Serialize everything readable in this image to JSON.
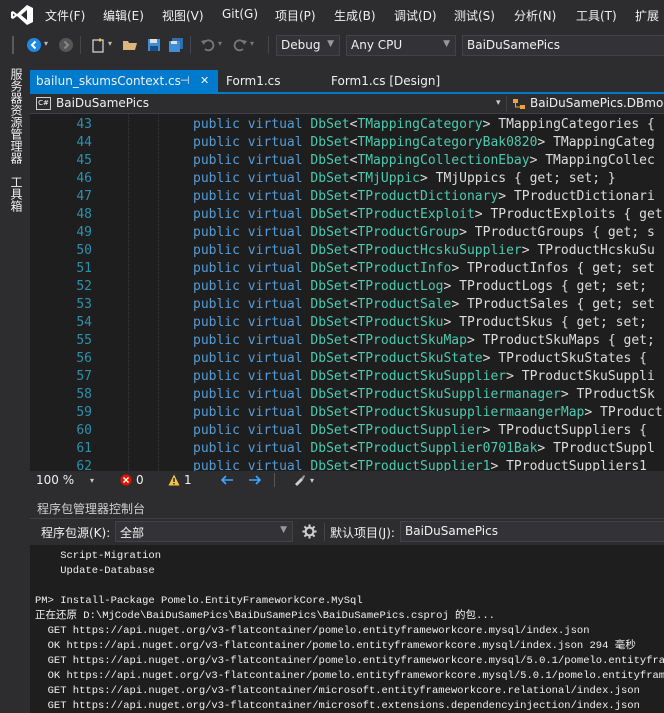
{
  "menu": {
    "items": [
      "文件(F)",
      "编辑(E)",
      "视图(V)",
      "Git(G)",
      "项目(P)",
      "生成(B)",
      "调试(D)",
      "测试(S)",
      "分析(N)",
      "工具(T)",
      "扩展"
    ]
  },
  "toolbar": {
    "config": "Debug",
    "platform": "Any CPU",
    "startup_project": "BaiDuSamePics"
  },
  "left_strip": {
    "server_explorer": "服务器资源管理器",
    "toolbox": "工具箱"
  },
  "tabs": [
    {
      "label": "bailun_skumsContext.cs",
      "pin": "⊣",
      "close": "✕"
    },
    {
      "label": "Form1.cs"
    },
    {
      "label": "Form1.cs [Design]"
    }
  ],
  "navbar": {
    "project": "BaiDuSamePics",
    "class": "BaiDuSamePics.DBmod",
    "project_badge": "C#"
  },
  "code": {
    "lines": [
      {
        "num": "43",
        "type": "TMappingCategory",
        "name": "TMappingCategories",
        "tail": " {"
      },
      {
        "num": "44",
        "type": "TMappingCategoryBak0820",
        "name": "TMappingCateg",
        "tail": ""
      },
      {
        "num": "45",
        "type": "TMappingCollectionEbay",
        "name": "TMappingCollec",
        "tail": ""
      },
      {
        "num": "46",
        "type": "TMjUppic",
        "name": "TMjUppics",
        "tail": " { get; set; }"
      },
      {
        "num": "47",
        "type": "TProductDictionary",
        "name": "TProductDictionari",
        "tail": ""
      },
      {
        "num": "48",
        "type": "TProductExploit",
        "name": "TProductExploits",
        "tail": " { get"
      },
      {
        "num": "49",
        "type": "TProductGroup",
        "name": "TProductGroups",
        "tail": " { get; s"
      },
      {
        "num": "50",
        "type": "TProductHcskuSupplier",
        "name": "TProductHcskuSu",
        "tail": ""
      },
      {
        "num": "51",
        "type": "TProductInfo",
        "name": "TProductInfos",
        "tail": " { get; set"
      },
      {
        "num": "52",
        "type": "TProductLog",
        "name": "TProductLogs",
        "tail": " { get; set;"
      },
      {
        "num": "53",
        "type": "TProductSale",
        "name": "TProductSales",
        "tail": " { get; set"
      },
      {
        "num": "54",
        "type": "TProductSku",
        "name": "TProductSkus",
        "tail": " { get; set;"
      },
      {
        "num": "55",
        "type": "TProductSkuMap",
        "name": "TProductSkuMaps",
        "tail": " { get;"
      },
      {
        "num": "56",
        "type": "TProductSkuState",
        "name": "TProductSkuStates",
        "tail": " {"
      },
      {
        "num": "57",
        "type": "TProductSkuSupplier",
        "name": "TProductSkuSuppli",
        "tail": ""
      },
      {
        "num": "58",
        "type": "TProductSkuSuppliermanager",
        "name": "TProductSk",
        "tail": ""
      },
      {
        "num": "59",
        "type": "TProductSkusuppliermaangerMap",
        "name": "TProduct",
        "tail": ""
      },
      {
        "num": "60",
        "type": "TProductSupplier",
        "name": "TProductSuppliers",
        "tail": " {"
      },
      {
        "num": "61",
        "type": "TProductSupplier0701Bak",
        "name": "TProductSuppl",
        "tail": ""
      },
      {
        "num": "62",
        "type": "TProductSupplier1",
        "name": "TProductSuppliers1",
        "tail": " "
      }
    ],
    "kw_public": "public",
    "kw_virtual": "virtual",
    "dbset": "DbSet"
  },
  "editor_status": {
    "zoom": "100 %",
    "errors": "0",
    "warnings": "1"
  },
  "panel": {
    "title": "程序包管理器控制台",
    "source_label": "程序包源(K):",
    "source_value": "全部",
    "default_project_label": "默认项目(J):",
    "default_project_value": "BaiDuSamePics"
  },
  "console": {
    "lines": [
      "    Script-Migration",
      "    Update-Database",
      "",
      "PM> Install-Package Pomelo.EntityFrameworkCore.MySql",
      "正在还原 D:\\MjCode\\BaiDuSamePics\\BaiDuSamePics\\BaiDuSamePics.csproj 的包...",
      "  GET https://api.nuget.org/v3-flatcontainer/pomelo.entityframeworkcore.mysql/index.json",
      "  OK https://api.nuget.org/v3-flatcontainer/pomelo.entityframeworkcore.mysql/index.json 294 毫秒",
      "  GET https://api.nuget.org/v3-flatcontainer/pomelo.entityframeworkcore.mysql/5.0.1/pomelo.entityframework",
      "  OK https://api.nuget.org/v3-flatcontainer/pomelo.entityframeworkcore.mysql/5.0.1/pomelo.entityframework",
      "  GET https://api.nuget.org/v3-flatcontainer/microsoft.entityframeworkcore.relational/index.json",
      "  GET https://api.nuget.org/v3-flatcontainer/microsoft.extensions.dependencyinjection/index.json"
    ]
  },
  "colors": {
    "accent": "#007acc",
    "keyword": "#569cd6",
    "type": "#4ec9b0",
    "line_number": "#2b91af"
  }
}
